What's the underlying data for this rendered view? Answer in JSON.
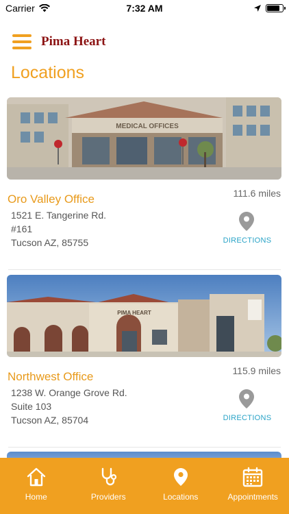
{
  "status_bar": {
    "carrier": "Carrier",
    "time": "7:32 AM",
    "battery_level": 0.9
  },
  "header": {
    "app_title": "Pima Heart",
    "page_title": "Locations"
  },
  "colors": {
    "accent": "#f0a020",
    "brand": "#8c1414",
    "link": "#29a3c7"
  },
  "locations": [
    {
      "name": "Oro Valley Office",
      "distance": "111.6 miles",
      "address_line1": "1521 E. Tangerine Rd.",
      "address_line2": "#161",
      "address_line3": "Tucson AZ, 85755",
      "directions_label": "DIRECTIONS",
      "photo_sign": "MEDICAL OFFICES"
    },
    {
      "name": "Northwest Office",
      "distance": "115.9 miles",
      "address_line1": "1238 W. Orange Grove Rd.",
      "address_line2": "Suite 103",
      "address_line3": "Tucson AZ, 85704",
      "directions_label": "DIRECTIONS",
      "photo_sign": "PIMA HEART"
    }
  ],
  "tabs": [
    {
      "label": "Home",
      "icon": "home-icon"
    },
    {
      "label": "Providers",
      "icon": "stethoscope-icon"
    },
    {
      "label": "Locations",
      "icon": "map-pin-icon"
    },
    {
      "label": "Appointments",
      "icon": "calendar-icon"
    }
  ]
}
